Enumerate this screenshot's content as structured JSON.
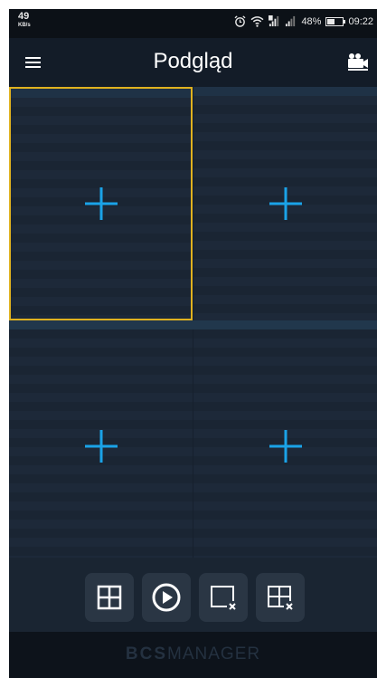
{
  "status_bar": {
    "net_speed": "49",
    "net_speed_unit": "KB/s",
    "battery": "48%",
    "battery_level": 0.48,
    "time": "09:22"
  },
  "app_bar": {
    "title": "Podgląd"
  },
  "grid": {
    "layout": "2x2",
    "selected_index": 0,
    "accent_color": "#e0b21f",
    "add_icon_color": "#1aa3e8"
  },
  "toolbar": {
    "buttons": [
      "grid-layout-icon",
      "play-icon",
      "close-channel-icon",
      "close-all-icon"
    ]
  },
  "footer": {
    "logo_bcs": "BCS",
    "logo_manager": "MANAGER"
  }
}
